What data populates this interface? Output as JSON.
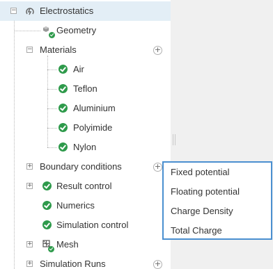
{
  "tree": {
    "root": {
      "label": "Electrostatics",
      "icon": "electrostatics-icon",
      "toggle": "−"
    },
    "geometry": {
      "label": "Geometry",
      "icon": "geometry-icon"
    },
    "materials": {
      "label": "Materials",
      "toggle": "−",
      "add": "+",
      "items": [
        {
          "label": "Air"
        },
        {
          "label": "Teflon"
        },
        {
          "label": "Aluminium"
        },
        {
          "label": "Polyimide"
        },
        {
          "label": "Nylon"
        }
      ]
    },
    "boundary_conditions": {
      "label": "Boundary conditions",
      "toggle": "+",
      "add": "+"
    },
    "result_control": {
      "label": "Result control",
      "toggle": "+"
    },
    "numerics": {
      "label": "Numerics"
    },
    "simulation_control": {
      "label": "Simulation control"
    },
    "mesh": {
      "label": "Mesh",
      "toggle": "+",
      "icon": "mesh-icon"
    },
    "simulation_runs": {
      "label": "Simulation Runs",
      "toggle": "+",
      "add": "+"
    }
  },
  "popup_menu": {
    "items": [
      {
        "label": "Fixed potential"
      },
      {
        "label": "Floating potential"
      },
      {
        "label": "Charge Density"
      },
      {
        "label": "Total Charge"
      }
    ]
  },
  "colors": {
    "selected_row": "#e3eef6",
    "check_green": "#2e9a4b",
    "menu_border": "#4a8fd0"
  }
}
